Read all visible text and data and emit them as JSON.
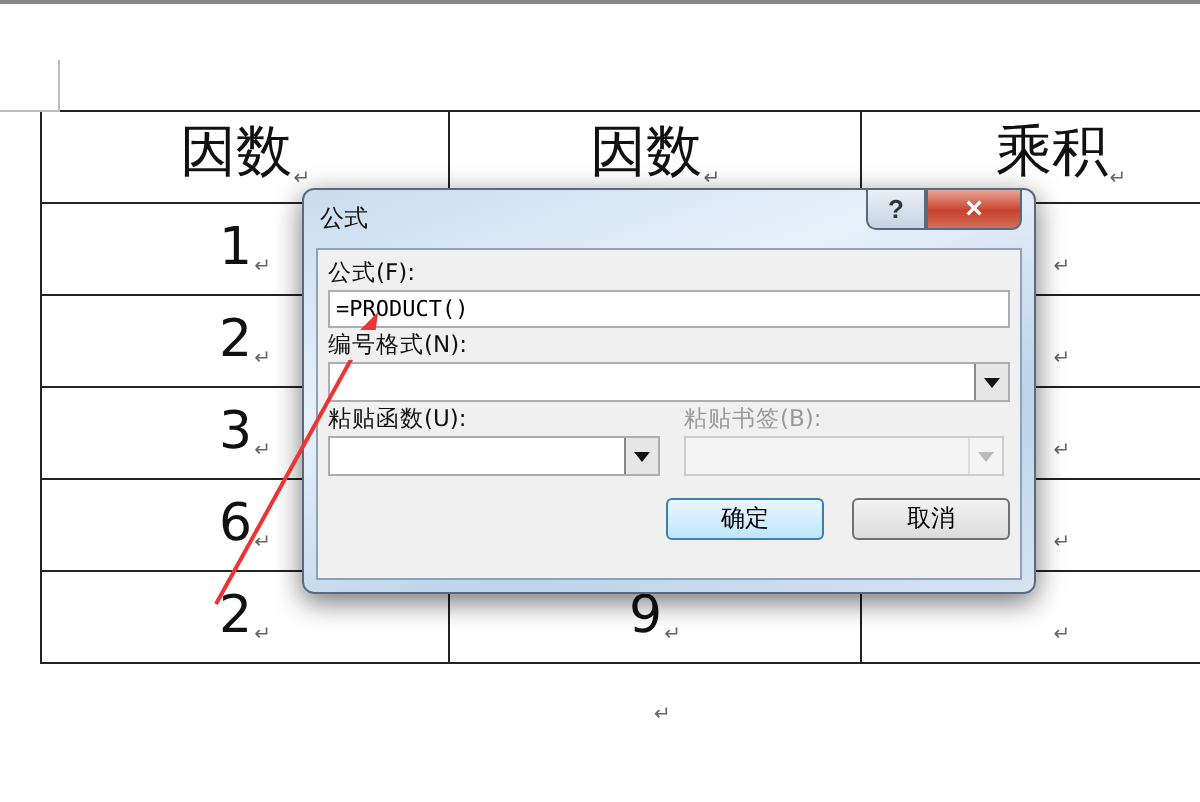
{
  "table": {
    "header": [
      {
        "text": "因数",
        "mark": "↵"
      },
      {
        "text": "因数",
        "mark": "↵"
      },
      {
        "text": "乘积",
        "mark": "↵"
      }
    ],
    "rows": [
      [
        {
          "text": "1",
          "mark": "↵"
        },
        null,
        {
          "mark": "↵"
        }
      ],
      [
        {
          "text": "2",
          "mark": "↵"
        },
        null,
        {
          "mark": "↵"
        }
      ],
      [
        {
          "text": "3",
          "mark": "↵"
        },
        null,
        {
          "mark": "↵"
        }
      ],
      [
        {
          "text": "6",
          "mark": "↵"
        },
        null,
        {
          "mark": "↵"
        }
      ],
      [
        {
          "text": "2",
          "mark": "↵"
        },
        {
          "text": "9",
          "mark": "↵"
        },
        {
          "mark": "↵"
        }
      ]
    ]
  },
  "below_mark": "↵",
  "dialog": {
    "title": "公式",
    "help": "?",
    "close": "×",
    "formula": {
      "label": "公式(F):",
      "value": "=PRODUCT()"
    },
    "number_format": {
      "label": "编号格式(N):",
      "disabled": false
    },
    "paste_function": {
      "label": "粘贴函数(U):",
      "disabled": false
    },
    "paste_bookmark": {
      "label": "粘贴书签(B):",
      "disabled": true
    },
    "buttons": [
      {
        "label": "确定",
        "default": true
      },
      {
        "label": "取消",
        "default": false
      }
    ]
  }
}
